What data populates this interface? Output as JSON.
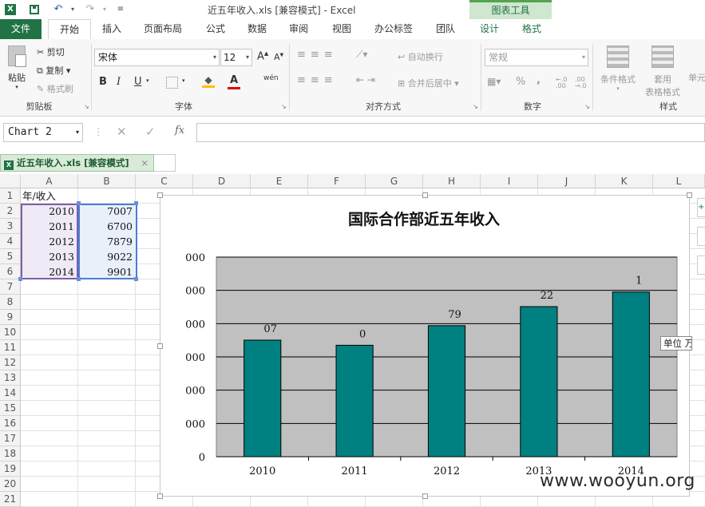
{
  "window": {
    "title": "近五年收入.xls  [兼容模式] - Excel",
    "context_tab_group": "图表工具"
  },
  "ribbon_tabs": [
    "文件",
    "开始",
    "插入",
    "页面布局",
    "公式",
    "数据",
    "审阅",
    "视图",
    "办公标签",
    "团队",
    "设计",
    "格式"
  ],
  "ribbon": {
    "clipboard": {
      "paste": "粘贴",
      "cut": "剪切",
      "copy": "复制",
      "format_painter": "格式刷",
      "label": "剪贴板"
    },
    "font": {
      "name": "宋体",
      "size": "12",
      "label": "字体",
      "bold": "B",
      "italic": "I",
      "underline": "U",
      "phonetic": "wén"
    },
    "alignment": {
      "wrap": "自动换行",
      "merge": "合并后居中",
      "label": "对齐方式"
    },
    "number": {
      "format": "常规",
      "percent": "%",
      "comma": ",",
      "label": "数字"
    },
    "styles": {
      "conditional": "条件格式",
      "table_format_1": "套用",
      "table_format_2": "表格格式",
      "cell_styles": "单元",
      "label": "样式"
    }
  },
  "formula_bar": {
    "name_box": "Chart 2",
    "fx": "fx",
    "value": ""
  },
  "workbook_tab": {
    "label": "近五年收入.xls  [兼容模式]",
    "close": "×"
  },
  "columns": [
    "A",
    "B",
    "C",
    "D",
    "E",
    "F",
    "G",
    "H",
    "I",
    "J",
    "K",
    "L"
  ],
  "rows": [
    "1",
    "2",
    "3",
    "4",
    "5",
    "6",
    "7",
    "8",
    "9",
    "10",
    "11",
    "12",
    "13",
    "14",
    "15",
    "16",
    "17",
    "18",
    "19",
    "20",
    "21"
  ],
  "cells": {
    "A1": "年/收入",
    "data": [
      {
        "year": "2010",
        "income": "7007"
      },
      {
        "year": "2011",
        "income": "6700"
      },
      {
        "year": "2012",
        "income": "7879"
      },
      {
        "year": "2013",
        "income": "9022"
      },
      {
        "year": "2014",
        "income": "9901"
      }
    ]
  },
  "chart_data": {
    "type": "bar",
    "title": "国际合作部近五年收入",
    "categories": [
      "2010",
      "2011",
      "2012",
      "2013",
      "2014"
    ],
    "values": [
      7007,
      6700,
      7879,
      9022,
      9901
    ],
    "data_labels_visible": [
      "07",
      "0",
      "79",
      "22",
      "1"
    ],
    "y_tick_labels": [
      "0",
      "000",
      "000",
      "000",
      "000",
      "000",
      "000"
    ],
    "ylim": [
      0,
      12000
    ],
    "grid": true,
    "plot_background": "#c0c0c0",
    "bar_color": "#008080",
    "side_label": "单位  万"
  },
  "watermark": "www.wooyun.org",
  "colors": {
    "excel_green": "#217346",
    "chart_tools": "#54a34d",
    "bar": "#008080"
  }
}
